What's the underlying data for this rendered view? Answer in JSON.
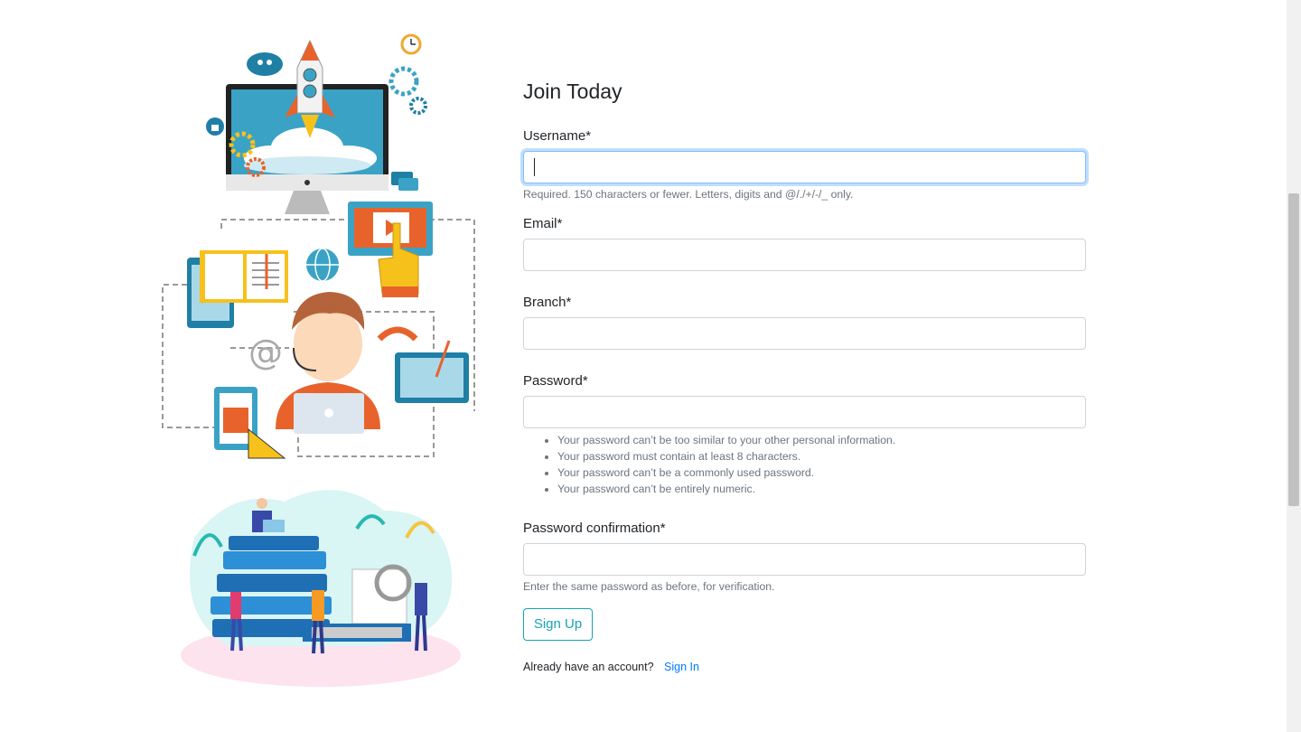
{
  "illustrations": {
    "top_icon": "elearning-illustration",
    "bottom_icon": "books-people-illustration",
    "email_symbol": "@"
  },
  "form": {
    "title": "Join Today",
    "username": {
      "label": "Username*",
      "value": "",
      "help": "Required. 150 characters or fewer. Letters, digits and @/./+/-/_ only."
    },
    "email": {
      "label": "Email*",
      "value": ""
    },
    "branch": {
      "label": "Branch*",
      "value": ""
    },
    "password": {
      "label": "Password*",
      "value": "",
      "rules": [
        "Your password can’t be too similar to your other personal information.",
        "Your password must contain at least 8 characters.",
        "Your password can’t be a commonly used password.",
        "Your password can’t be entirely numeric."
      ]
    },
    "password_confirmation": {
      "label": "Password confirmation*",
      "value": "",
      "help": "Enter the same password as before, for verification."
    },
    "submit_label": "Sign Up",
    "account_prompt": "Already have an account?",
    "sign_in_label": "Sign In"
  },
  "colors": {
    "accent": "#17a2b8",
    "link": "#007bff",
    "focus": "#80bdff"
  }
}
